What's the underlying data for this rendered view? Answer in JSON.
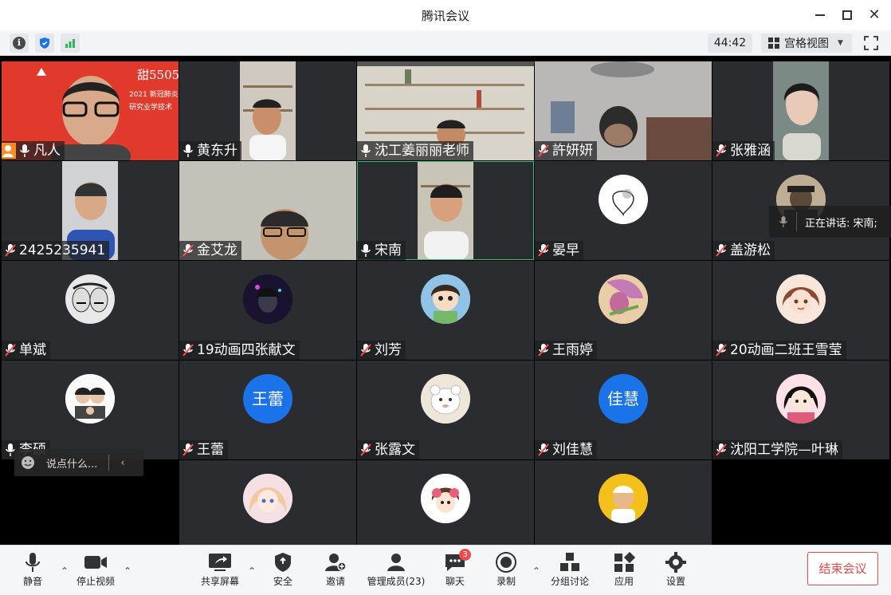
{
  "window": {
    "title": "腾讯会议"
  },
  "infobar": {
    "timer": "44:42",
    "view_label": "宫格视图"
  },
  "tiles": [
    {
      "name": "凡人",
      "kind": "video",
      "mic": "on",
      "host": true
    },
    {
      "name": "黄东升",
      "kind": "video",
      "mic": "on"
    },
    {
      "name": "沈工姜丽丽老师",
      "kind": "video",
      "mic": "on"
    },
    {
      "name": "許妍妍",
      "kind": "video",
      "mic": "muted"
    },
    {
      "name": "张雅涵",
      "kind": "video",
      "mic": "muted"
    },
    {
      "name": "2425235941",
      "kind": "video",
      "mic": "muted"
    },
    {
      "name": "金艾龙",
      "kind": "video",
      "mic": "muted"
    },
    {
      "name": "宋南",
      "kind": "video",
      "mic": "on",
      "active": true
    },
    {
      "name": "晏早",
      "kind": "avatar",
      "mic": "muted"
    },
    {
      "name": "盖游松",
      "kind": "avatar",
      "mic": "muted"
    },
    {
      "name": "单斌",
      "kind": "avatar",
      "mic": "muted"
    },
    {
      "name": "19动画四张献文",
      "kind": "avatar",
      "mic": "muted"
    },
    {
      "name": "刘芳",
      "kind": "avatar",
      "mic": "muted"
    },
    {
      "name": "王雨婷",
      "kind": "avatar",
      "mic": "muted"
    },
    {
      "name": "20动画二班王雪莹",
      "kind": "avatar",
      "mic": "muted"
    },
    {
      "name": "李硕",
      "kind": "avatar",
      "mic": "on"
    },
    {
      "name": "王蕾",
      "kind": "letter",
      "letter": "王蕾",
      "mic": "muted"
    },
    {
      "name": "张露文",
      "kind": "avatar",
      "mic": "muted"
    },
    {
      "name": "刘佳慧",
      "kind": "letter",
      "letter": "佳慧",
      "mic": "muted"
    },
    {
      "name": "沈阳工学院—叶琳",
      "kind": "avatar",
      "mic": "muted"
    }
  ],
  "speaking": {
    "label": "正在讲话: 宋南;"
  },
  "chat": {
    "placeholder": "说点什么..."
  },
  "toolbar": {
    "mute": "静音",
    "video": "停止视频",
    "share": "共享屏幕",
    "security": "安全",
    "invite": "邀请",
    "members": "管理成员(23)",
    "chat": "聊天",
    "chat_badge": "3",
    "record": "录制",
    "breakout": "分组讨论",
    "apps": "应用",
    "settings": "设置",
    "end": "结束会议"
  },
  "colors": {
    "accent_blue": "#1a73e8",
    "host_orange": "#ff8a1f",
    "end_red": "#e94a4a",
    "active_green": "#3fbf7f"
  }
}
